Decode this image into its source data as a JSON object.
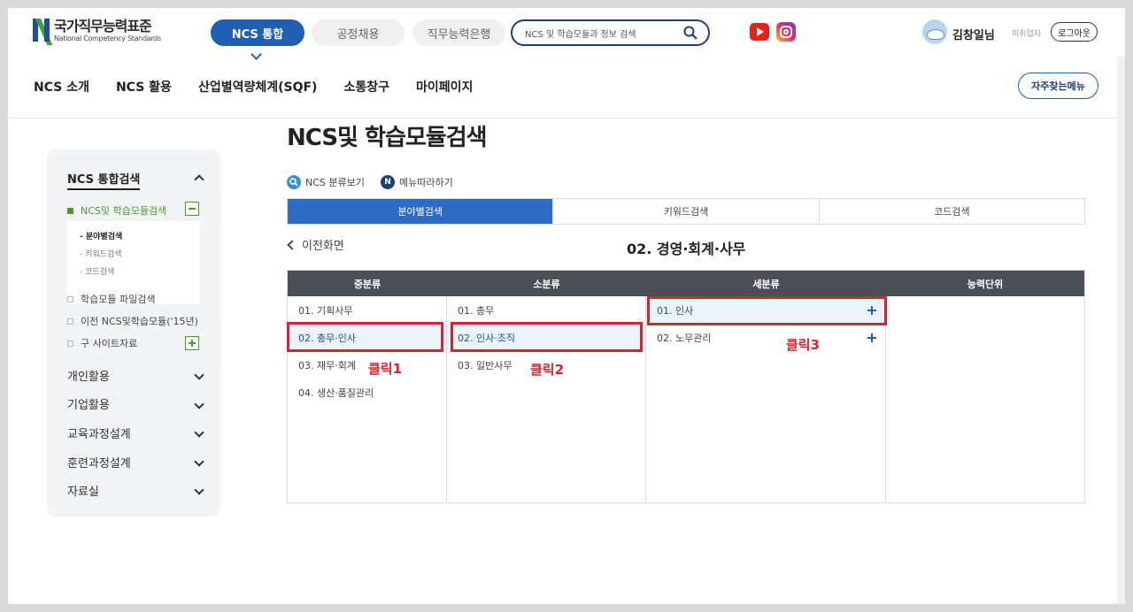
{
  "header": {
    "logo_ko": "국가직무능력표준",
    "logo_en": "National Competency Standards",
    "top_tabs": [
      {
        "label": "NCS 통합",
        "active": true
      },
      {
        "label": "공정채용",
        "active": false
      },
      {
        "label": "직무능력은행",
        "active": false
      }
    ],
    "search_placeholder": "NCS 및 학습모듈과 정보 검색",
    "user_name": "김창일님",
    "withdraw_label": "미취업자",
    "logout_label": "로그아웃",
    "nav": [
      "NCS 소개",
      "NCS 활용",
      "산업별역량체계(SQF)",
      "소통창구",
      "마이페이지"
    ],
    "faq_label": "자주찾는메뉴"
  },
  "sidebar": {
    "title": "NCS 통합검색",
    "active_item": "NCS및 학습모듈검색",
    "sub_items": [
      {
        "label": "분야별검색",
        "on": true
      },
      {
        "label": "키워드검색",
        "on": false
      },
      {
        "label": "코드검색",
        "on": false
      }
    ],
    "items": [
      "학습모듈 파일검색",
      "이전 NCS및학습모듈('15년)",
      "구 사이트자료"
    ],
    "menus": [
      "개인활용",
      "기업활용",
      "교육과정설계",
      "훈련과정설계",
      "자료실"
    ]
  },
  "main": {
    "page_title": "NCS및 학습모듈검색",
    "legend": [
      {
        "icon": "search-icon",
        "label": "NCS 분류보기",
        "color": "#3d8fd6"
      },
      {
        "icon": "n-icon",
        "label": "메뉴따라하기",
        "color": "#1e3f73"
      }
    ],
    "tabs": [
      {
        "label": "분야별검색",
        "on": true
      },
      {
        "label": "키워드검색",
        "on": false
      },
      {
        "label": "코드검색",
        "on": false
      }
    ],
    "back_label": "이전화면",
    "section_title": "02. 경영·회계·사무",
    "columns": [
      "중분류",
      "소분류",
      "세분류",
      "능력단위"
    ],
    "mid": [
      "01. 기획사무",
      "02. 총무·인사",
      "03. 재무·회계",
      "04. 생산·품질관리"
    ],
    "small": [
      "01. 총무",
      "02. 인사·조직",
      "03. 일반사무"
    ],
    "detail": [
      "01. 인사",
      "02. 노무관리"
    ],
    "click_labels": [
      "클릭1",
      "클릭2",
      "클릭3"
    ]
  },
  "colors": {
    "primary": "#1e5eb3",
    "tab_active": "#2e6bc4",
    "sidebar_active": "#4b9a2f",
    "highlight_red": "#d3252f",
    "grid_header": "#4a4e57"
  }
}
